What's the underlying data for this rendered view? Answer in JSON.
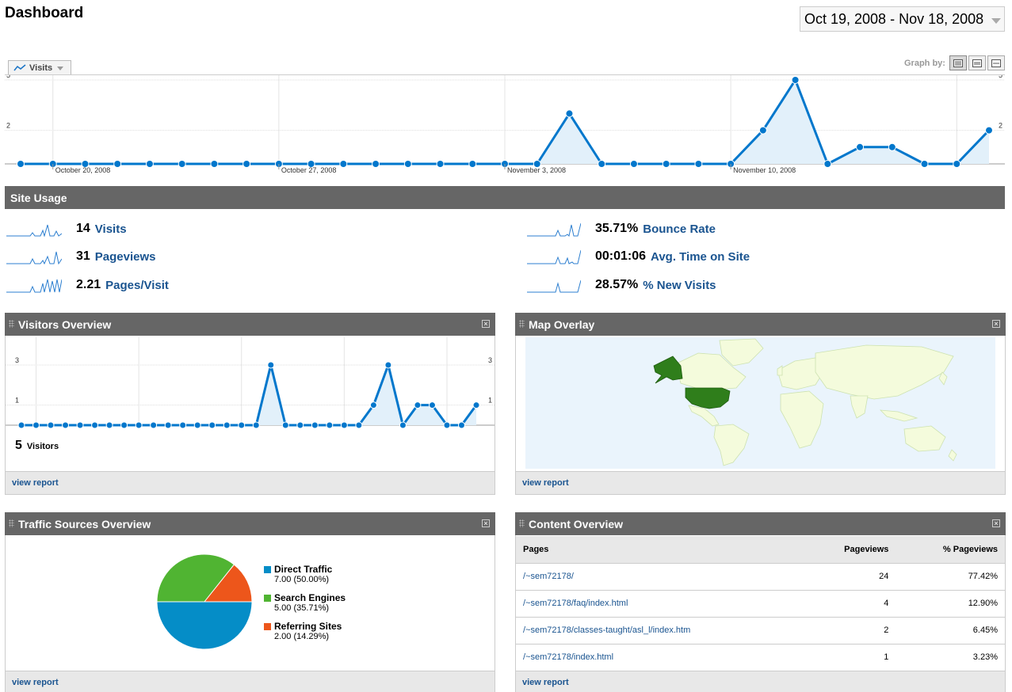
{
  "page": {
    "title": "Dashboard"
  },
  "date_range": {
    "label": "Oct 19, 2008 - Nov 18, 2008"
  },
  "metric_selector": {
    "label": "Visits"
  },
  "graph_by": {
    "label": "Graph by:",
    "options": [
      "day",
      "week",
      "month"
    ],
    "selected": "day"
  },
  "main_chart": {
    "y_ticks": [
      "5",
      "2"
    ],
    "x_labels": [
      "October 20, 2008",
      "October 27, 2008",
      "November 3, 2008",
      "November 10, 2008"
    ]
  },
  "site_usage": {
    "title": "Site Usage",
    "left": [
      {
        "value": "14",
        "label": "Visits"
      },
      {
        "value": "31",
        "label": "Pageviews"
      },
      {
        "value": "2.21",
        "label": "Pages/Visit"
      }
    ],
    "right": [
      {
        "value": "35.71%",
        "label": "Bounce Rate"
      },
      {
        "value": "00:01:06",
        "label": "Avg. Time on Site"
      },
      {
        "value": "28.57%",
        "label": "% New Visits"
      }
    ]
  },
  "visitors_overview": {
    "title": "Visitors Overview",
    "y_ticks": [
      "3",
      "1"
    ],
    "count": "5",
    "count_label": "Visitors",
    "footer_link": "view report"
  },
  "map_overlay": {
    "title": "Map Overlay",
    "footer_link": "view report"
  },
  "traffic_sources": {
    "title": "Traffic Sources Overview",
    "footer_link": "view report",
    "items": [
      {
        "name": "Direct Traffic",
        "value": "7.00 (50.00%)",
        "color": "#058dc7"
      },
      {
        "name": "Search Engines",
        "value": "5.00 (35.71%)",
        "color": "#50b432"
      },
      {
        "name": "Referring Sites",
        "value": "2.00 (14.29%)",
        "color": "#ed561b"
      }
    ]
  },
  "content_overview": {
    "title": "Content Overview",
    "footer_link": "view report",
    "columns": [
      "Pages",
      "Pageviews",
      "% Pageviews"
    ],
    "rows": [
      {
        "page": "/~sem72178/",
        "pageviews": "24",
        "percent": "77.42%"
      },
      {
        "page": "/~sem72178/faq/index.html",
        "pageviews": "4",
        "percent": "12.90%"
      },
      {
        "page": "/~sem72178/classes-taught/asl_l/index.htm",
        "pageviews": "2",
        "percent": "6.45%"
      },
      {
        "page": "/~sem72178/index.html",
        "pageviews": "1",
        "percent": "3.23%"
      }
    ]
  },
  "chart_data": [
    {
      "type": "line",
      "name": "main-visits-chart",
      "x": [
        "Oct 19",
        "Oct 20",
        "Oct 21",
        "Oct 22",
        "Oct 23",
        "Oct 24",
        "Oct 25",
        "Oct 26",
        "Oct 27",
        "Oct 28",
        "Oct 29",
        "Oct 30",
        "Oct 31",
        "Nov 1",
        "Nov 2",
        "Nov 3",
        "Nov 4",
        "Nov 5",
        "Nov 6",
        "Nov 7",
        "Nov 8",
        "Nov 9",
        "Nov 10",
        "Nov 11",
        "Nov 12",
        "Nov 13",
        "Nov 14",
        "Nov 15",
        "Nov 16",
        "Nov 17",
        "Nov 18"
      ],
      "series": [
        {
          "values": [
            0,
            0,
            0,
            0,
            0,
            0,
            0,
            0,
            0,
            0,
            0,
            0,
            0,
            0,
            0,
            0,
            0,
            3,
            0,
            0,
            0,
            0,
            0,
            2,
            5,
            0,
            1,
            1,
            0,
            0,
            2
          ]
        }
      ],
      "ylim": [
        0,
        5
      ],
      "y_ticks": [
        5,
        2
      ],
      "grid": true
    },
    {
      "type": "line",
      "name": "visitors-overview-chart",
      "series": [
        {
          "values": [
            0,
            0,
            0,
            0,
            0,
            0,
            0,
            0,
            0,
            0,
            0,
            0,
            0,
            0,
            0,
            0,
            0,
            3,
            0,
            0,
            0,
            0,
            0,
            0,
            1,
            3,
            0,
            1,
            1,
            0,
            0,
            1
          ]
        }
      ],
      "ylim": [
        0,
        3
      ],
      "y_ticks": [
        3,
        1
      ],
      "grid": true
    },
    {
      "type": "pie",
      "name": "traffic-sources-chart",
      "categories": [
        "Direct Traffic",
        "Search Engines",
        "Referring Sites"
      ],
      "values": [
        7,
        5,
        2
      ],
      "colors": [
        "#058dc7",
        "#50b432",
        "#ed561b"
      ]
    }
  ]
}
